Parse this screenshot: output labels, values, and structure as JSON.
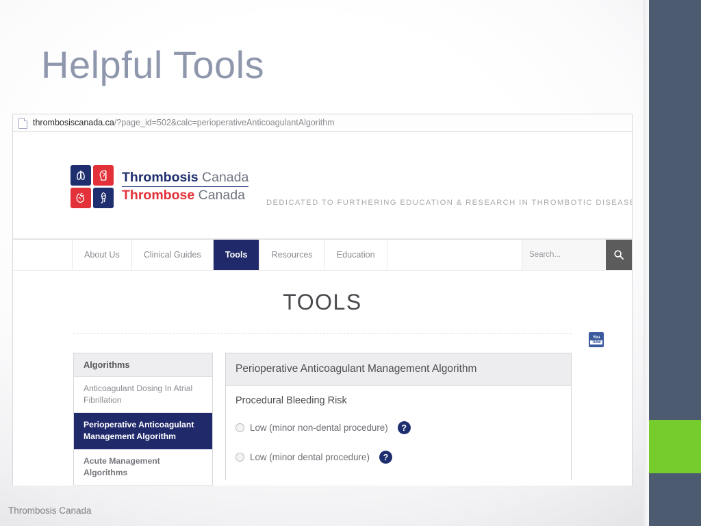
{
  "slide": {
    "title": "Helpful Tools",
    "footer": "Thrombosis Canada",
    "accent_green": "#76cc2c",
    "band_color": "#4d5b70",
    "title_color": "#8f97ad"
  },
  "browser": {
    "url_icon": "page-icon",
    "url_domain": "thrombosiscanada.ca",
    "url_path": "/?page_id=502&calc=perioperativeAnticoagulantAlgorithm"
  },
  "site": {
    "logo": {
      "line1_bold": "Thrombosis",
      "line1_light": "Canada",
      "line2_bold": "Thrombose",
      "line2_light": "Canada",
      "tiles": [
        "lungs-icon",
        "head-icon",
        "heart-icon",
        "leg-icon"
      ],
      "navy": "#1f2e6e",
      "red": "#e23138"
    },
    "tagline": "DEDICATED TO FURTHERING EDUCATION & RESEARCH IN THROMBOTIC DISEASE",
    "social": {
      "youtube_top": "You",
      "youtube_bottom": "Tube"
    },
    "nav": {
      "items": [
        {
          "label": "About Us",
          "active": false
        },
        {
          "label": "Clinical Guides",
          "active": false
        },
        {
          "label": "Tools",
          "active": true
        },
        {
          "label": "Resources",
          "active": false
        },
        {
          "label": "Education",
          "active": false
        }
      ],
      "active_color": "#202a6b",
      "search_placeholder": "Search...",
      "search_icon": "search-icon"
    }
  },
  "page": {
    "heading": "TOOLS",
    "sidebar": {
      "header": "Algorithms",
      "items": [
        {
          "label": "Anticoagulant Dosing In Atrial Fibrillation",
          "active": false
        },
        {
          "label": "Perioperative Anticoagulant Management Algorithm",
          "active": true
        },
        {
          "label": "Acute Management Algorithms",
          "active": false
        }
      ]
    },
    "panel": {
      "title": "Perioperative Anticoagulant Management Algorithm",
      "section_label": "Procedural Bleeding Risk",
      "options": [
        {
          "label": "Low (minor non-dental procedure)",
          "selected": false,
          "help": "?"
        },
        {
          "label": "Low (minor dental procedure)",
          "selected": false,
          "help": "?"
        }
      ]
    }
  }
}
